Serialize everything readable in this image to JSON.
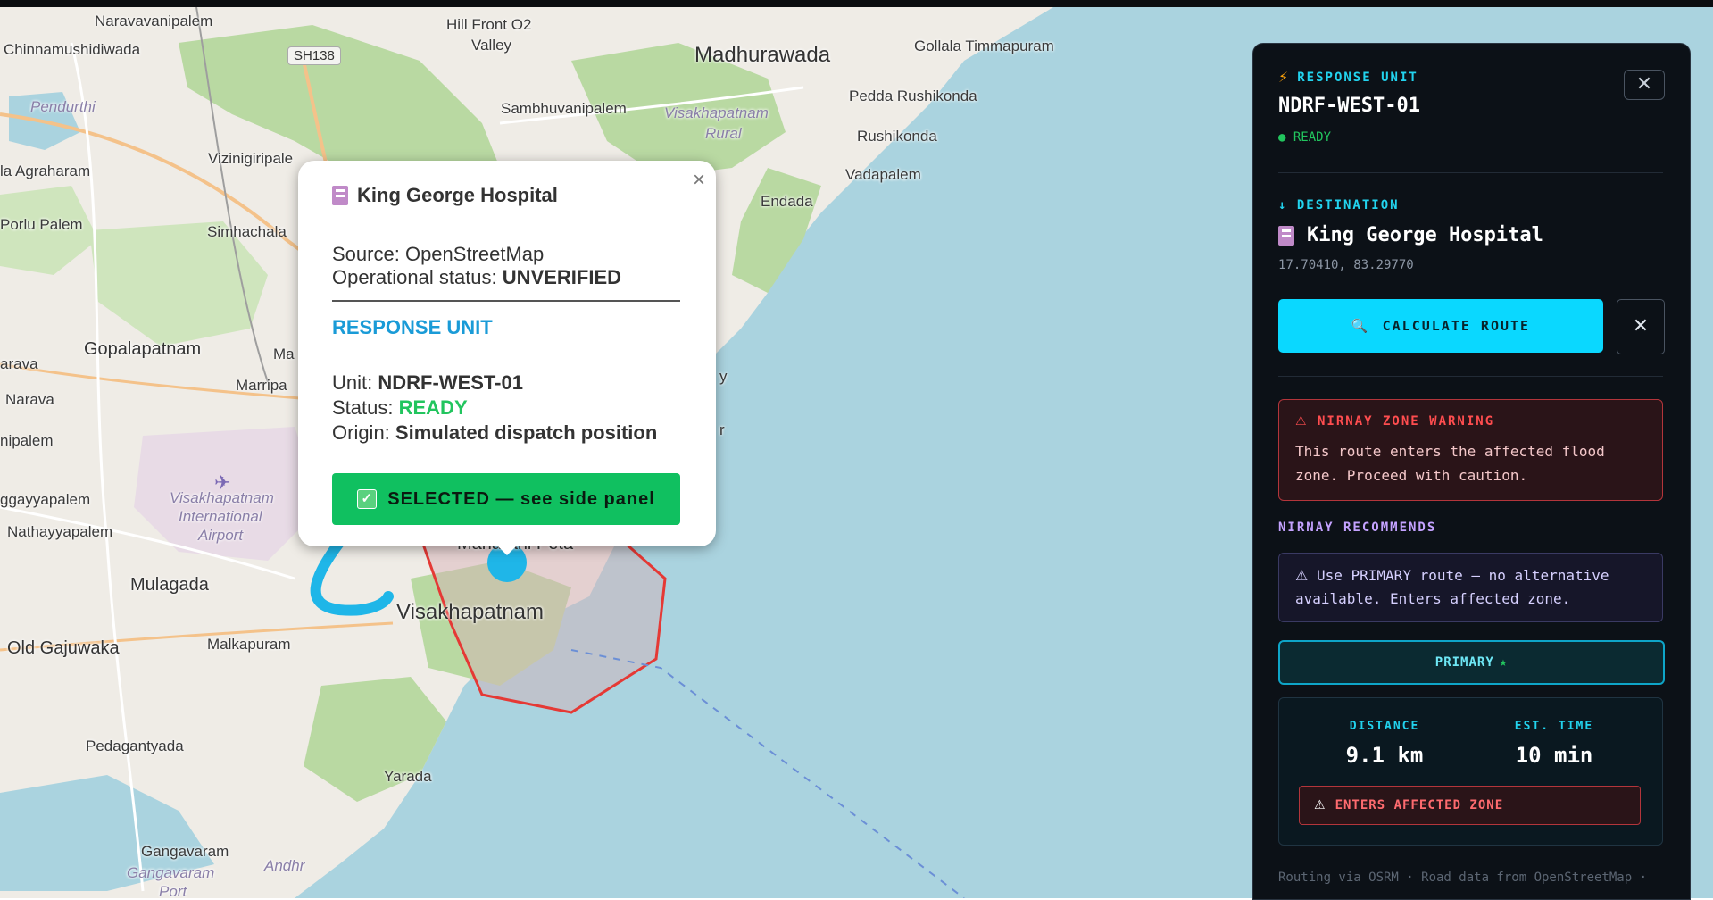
{
  "map": {
    "labels": {
      "naravavanipalem": "Naravavanipalem",
      "chinnamushidiwada": "Chinnamushidiwada",
      "hill_front": "Hill Front O2",
      "valley": "Valley",
      "madhurawada": "Madhurawada",
      "gollala": "Gollala Timmapuram",
      "madhurawada_top": "Madhurawada",
      "pendurthi": "Pendurthi",
      "sambhuvanipalem": "Sambhuvanipalem",
      "visakhapatnam_rural": "Visakhapatnam",
      "rural": "Rural",
      "pedda_rushikonda": "Pedda Rushikonda",
      "rushikonda": "Rushikonda",
      "agraharam": "la Agraharam",
      "vizinigiripale": "Vizinigiripale",
      "vadapalem": "Vadapalem",
      "endada": "Endada",
      "porlu_palem": "Porlu Palem",
      "simhachala": "Simhachala",
      "gopalapatnam": "Gopalapatnam",
      "ma": "Ma",
      "marripa": "Marripa",
      "arava": "arava",
      "narava": "Narava",
      "nipalem": "nipalem",
      "gayyapalem": "ggayyapalem",
      "nathayyapalem": "Nathayyapalem",
      "airport1": "Visakhapatnam",
      "airport2": "International",
      "airport3": "Airport",
      "mulagada": "Mulagada",
      "old_gajuwaka": "Old Gajuwaka",
      "malkapuram": "Malkapuram",
      "maharani_peta": "Maharani Peta",
      "visakhapatnam": "Visakhapatnam",
      "pedagantyada": "Pedagantyada",
      "yarada": "Yarada",
      "gangavaram": "Gangavaram",
      "gangavaram2": "Gangavaram",
      "andhra": "Andhr",
      "port": "Port",
      "y_partial": "y",
      "r_partial": "r"
    },
    "road_shield": "SH138"
  },
  "popup": {
    "title": "King George Hospital",
    "source_label": "Source:",
    "source_value": "OpenStreetMap",
    "op_status_label": "Operational status:",
    "op_status_value": "UNVERIFIED",
    "section": "RESPONSE UNIT",
    "unit_label": "Unit:",
    "unit_value": "NDRF-WEST-01",
    "status_label": "Status:",
    "status_value": "READY",
    "origin_label": "Origin:",
    "origin_value": "Simulated dispatch position",
    "selected_button": "SELECTED — see side panel",
    "close": "×"
  },
  "panel": {
    "header_label": "RESPONSE UNIT",
    "unit_name": "NDRF-WEST-01",
    "status": "● READY",
    "close": "✕",
    "dest_label": "↓ DESTINATION",
    "dest_name": "King George Hospital",
    "dest_coords": "17.70410, 83.29770",
    "calc_button": "CALCULATE ROUTE",
    "clear_button": "✕",
    "warning_title": "NIRNAY ZONE WARNING",
    "warning_body": "This route enters the affected flood zone. Proceed with caution.",
    "recommends_title": "NIRNAY RECOMMENDS",
    "recommends_body": "Use PRIMARY route — no alternative available. Enters affected zone.",
    "primary_label": "PRIMARY",
    "primary_star": "★",
    "distance_label": "DISTANCE",
    "distance_value": "9.1 km",
    "time_label": "EST. TIME",
    "time_value": "10 min",
    "zone_badge": "ENTERS AFFECTED ZONE",
    "footer": "Routing via OSRM · Road data from OpenStreetMap ·"
  },
  "colors": {
    "accent": "#0ad8ff",
    "ready": "#22c55e",
    "warning": "#ff4d4f",
    "recommend": "#c4a2ff",
    "flood_zone": "#e53935",
    "route": "#1fb6e8"
  }
}
